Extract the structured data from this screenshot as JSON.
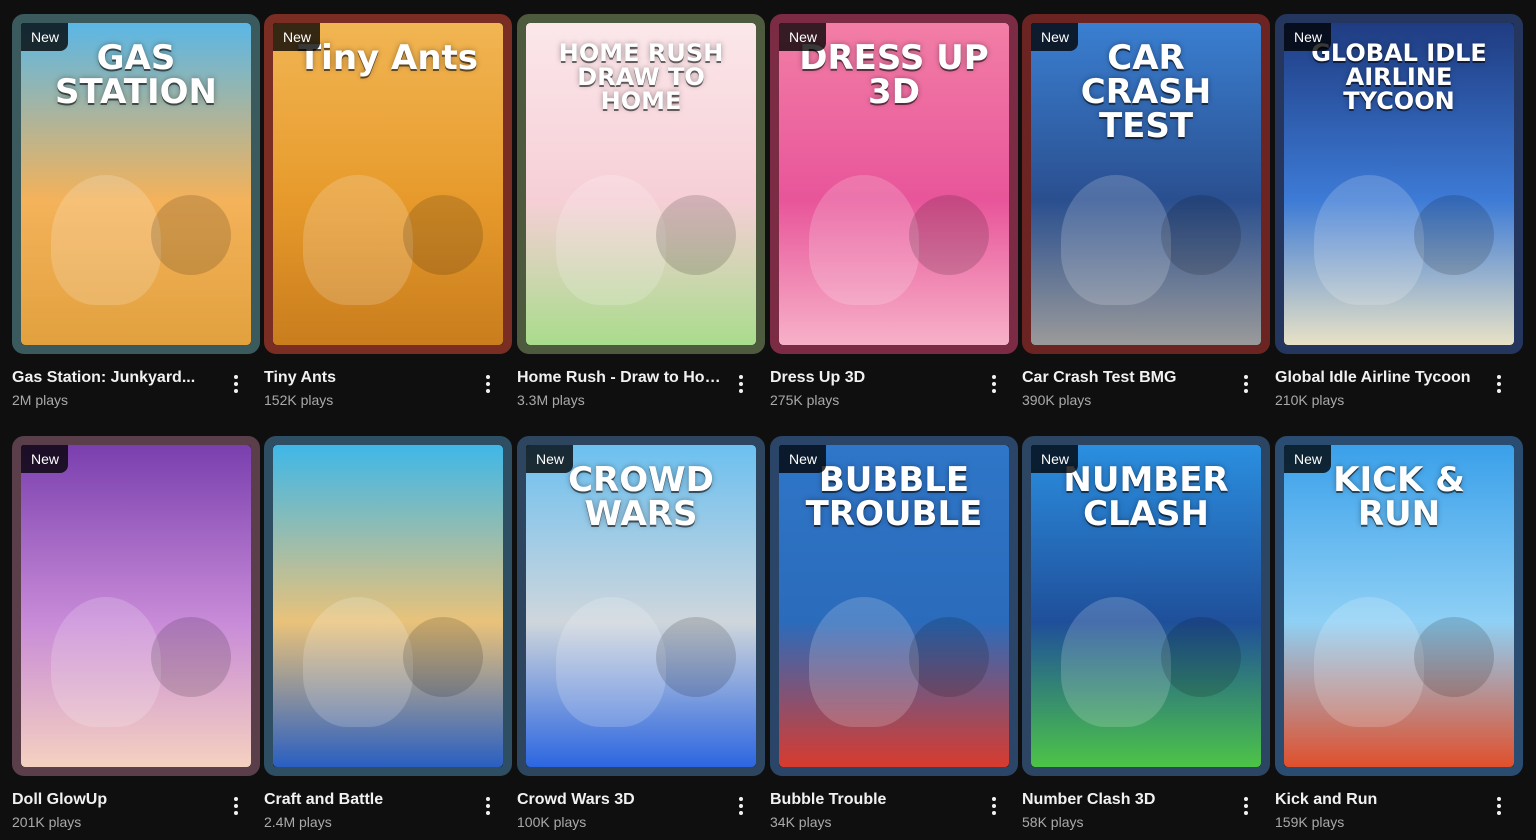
{
  "badge_text": "New",
  "games": [
    {
      "title": "Gas Station: Junkyard...",
      "plays": "2M plays",
      "is_new": true,
      "art_text": "GAS STATION",
      "border": "#3a5a5e",
      "colors": [
        "#5ab7e6",
        "#f4b25a",
        "#e2a13e"
      ]
    },
    {
      "title": "Tiny Ants",
      "plays": "152K plays",
      "is_new": true,
      "art_text": "Tiny Ants",
      "border": "#7a2d22",
      "colors": [
        "#f1b553",
        "#e79a2b",
        "#c97d1d"
      ]
    },
    {
      "title": "Home Rush - Draw to Home",
      "plays": "3.3M plays",
      "is_new": false,
      "art_text": "HOME RUSH DRAW TO HOME",
      "border": "#4e5a3e",
      "colors": [
        "#fbe7ea",
        "#f6cfd6",
        "#a9dc8c"
      ]
    },
    {
      "title": "Dress Up 3D",
      "plays": "275K plays",
      "is_new": true,
      "art_text": "DRESS UP 3D",
      "border": "#7b2b44",
      "colors": [
        "#f27ea6",
        "#e8559a",
        "#f7b1c8"
      ]
    },
    {
      "title": "Car Crash Test BMG",
      "plays": "390K plays",
      "is_new": true,
      "art_text": "CAR CRASH TEST",
      "border": "#6b2421",
      "colors": [
        "#3a7fd1",
        "#2a4f8f",
        "#9a9a9a"
      ]
    },
    {
      "title": "Global Idle Airline Tycoon",
      "plays": "210K plays",
      "is_new": true,
      "art_text": "GLOBAL IDLE AIRLINE TYCOON",
      "border": "#24365e",
      "colors": [
        "#1f3c82",
        "#3d7bd6",
        "#e8e2c6"
      ]
    },
    {
      "title": "Doll GlowUp",
      "plays": "201K plays",
      "is_new": true,
      "art_text": "",
      "border": "#5a3e4a",
      "colors": [
        "#7a3fae",
        "#c88bd8",
        "#f5d1c0"
      ]
    },
    {
      "title": "Craft and Battle",
      "plays": "2.4M plays",
      "is_new": false,
      "art_text": "",
      "border": "#2d4e63",
      "colors": [
        "#3fb7e8",
        "#e9c27a",
        "#2a5fc1"
      ]
    },
    {
      "title": "Crowd Wars 3D",
      "plays": "100K plays",
      "is_new": true,
      "art_text": "CROWD WARS",
      "border": "#2e4560",
      "colors": [
        "#6cc0f0",
        "#cfd6dc",
        "#2c66e0"
      ]
    },
    {
      "title": "Bubble Trouble",
      "plays": "34K plays",
      "is_new": true,
      "art_text": "BUBBLE TROUBLE",
      "border": "#2a4568",
      "colors": [
        "#2f76c8",
        "#2b6bbb",
        "#d83b2e"
      ]
    },
    {
      "title": "Number Clash 3D",
      "plays": "58K plays",
      "is_new": true,
      "art_text": "NUMBER CLASH",
      "border": "#2b4563",
      "colors": [
        "#2b8fe0",
        "#1f4f9a",
        "#4cc447"
      ]
    },
    {
      "title": "Kick and Run",
      "plays": "159K plays",
      "is_new": true,
      "art_text": "KICK & RUN",
      "border": "#2a4c70",
      "colors": [
        "#3aa0ea",
        "#8fd0f5",
        "#e0502c"
      ]
    }
  ]
}
